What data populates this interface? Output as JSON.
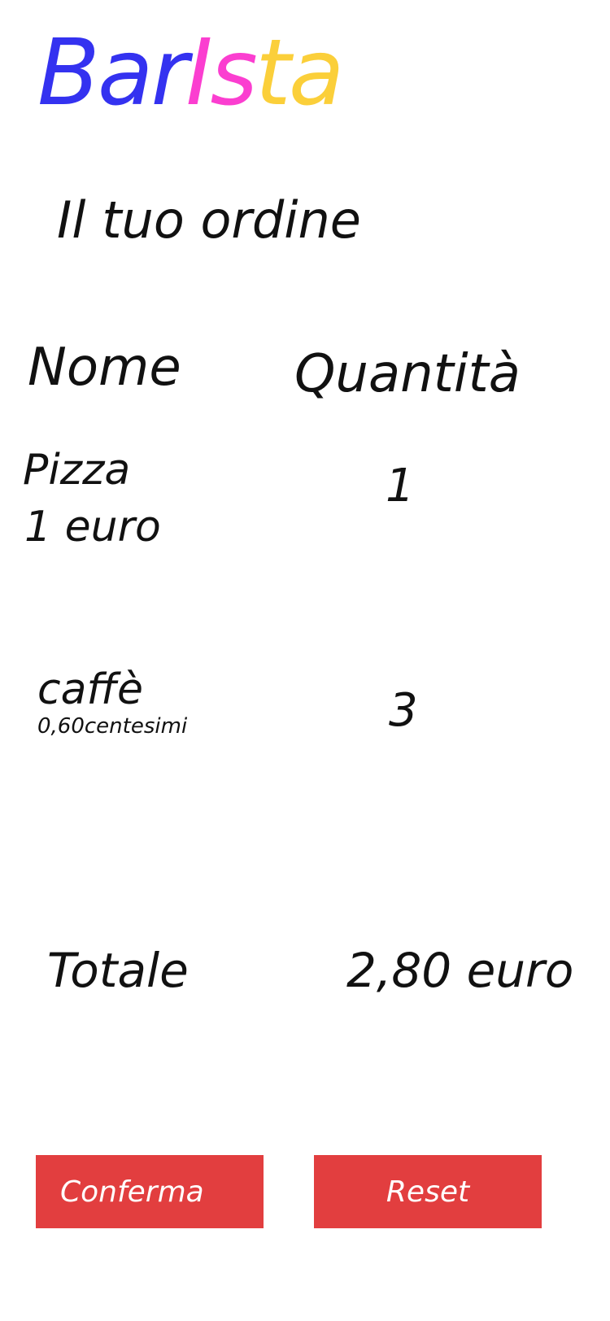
{
  "logo": {
    "parts": [
      {
        "text": "Bar",
        "color": "#3432f0"
      },
      {
        "text": "I",
        "color": "#fb3ed0"
      },
      {
        "text": "s",
        "color": "#fb3ed0"
      },
      {
        "text": "ta",
        "color": "#fbcf3a"
      }
    ]
  },
  "title": "Il tuo ordine",
  "columns": {
    "name": "Nome",
    "quantity": "Quantità"
  },
  "items": [
    {
      "name": "Pizza",
      "price": "1 euro",
      "quantity": "1"
    },
    {
      "name": "caffè",
      "price": "0,60centesimi",
      "quantity": "3"
    }
  ],
  "total": {
    "label": "Totale",
    "value": "2,80 euro"
  },
  "buttons": {
    "confirm": "Conferma",
    "reset": "Reset",
    "color": "#e23e3f",
    "text_color": "#ffffff"
  }
}
